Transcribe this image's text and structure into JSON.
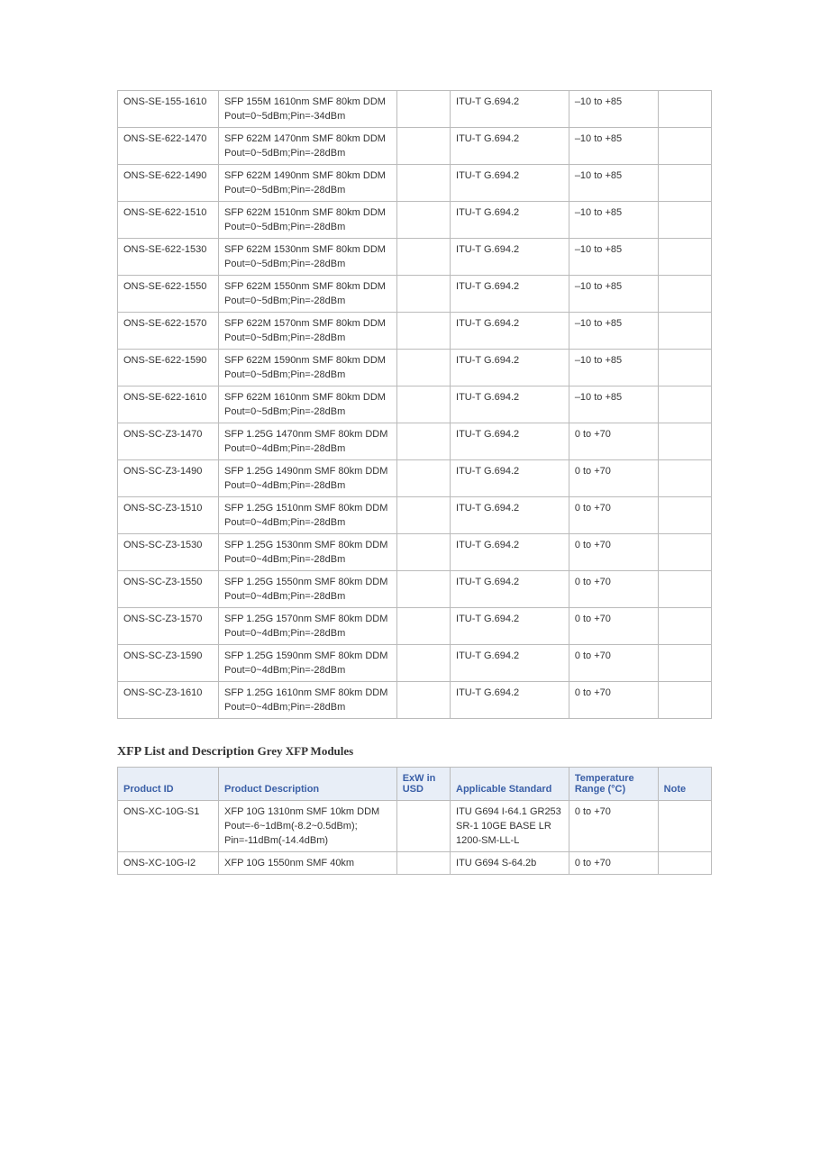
{
  "table1": {
    "rows": [
      {
        "id": "ONS-SE-155-1610",
        "desc": [
          "SFP 155M 1610nm SMF 80km DDM",
          "Pout=0~5dBm;Pin=-34dBm"
        ],
        "exw": "",
        "std": "ITU-T G.694.2",
        "temp": "–10 to +85",
        "note": ""
      },
      {
        "id": "ONS-SE-622-1470",
        "desc": [
          "SFP 622M 1470nm SMF 80km DDM",
          "Pout=0~5dBm;Pin=-28dBm"
        ],
        "exw": "",
        "std": "ITU-T G.694.2",
        "temp": "–10 to +85",
        "note": ""
      },
      {
        "id": "ONS-SE-622-1490",
        "desc": [
          "SFP 622M 1490nm SMF 80km DDM",
          "Pout=0~5dBm;Pin=-28dBm"
        ],
        "exw": "",
        "std": "ITU-T G.694.2",
        "temp": "–10 to +85",
        "note": ""
      },
      {
        "id": "ONS-SE-622-1510",
        "desc": [
          "SFP 622M 1510nm SMF 80km DDM",
          "Pout=0~5dBm;Pin=-28dBm"
        ],
        "exw": "",
        "std": "ITU-T G.694.2",
        "temp": "–10 to +85",
        "note": ""
      },
      {
        "id": "ONS-SE-622-1530",
        "desc": [
          "SFP 622M 1530nm SMF 80km DDM",
          "Pout=0~5dBm;Pin=-28dBm"
        ],
        "exw": "",
        "std": "ITU-T G.694.2",
        "temp": "–10 to +85",
        "note": ""
      },
      {
        "id": "ONS-SE-622-1550",
        "desc": [
          "SFP 622M 1550nm SMF 80km DDM",
          "Pout=0~5dBm;Pin=-28dBm"
        ],
        "exw": "",
        "std": "ITU-T G.694.2",
        "temp": "–10 to +85",
        "note": ""
      },
      {
        "id": "ONS-SE-622-1570",
        "desc": [
          "SFP 622M 1570nm SMF 80km DDM",
          "Pout=0~5dBm;Pin=-28dBm"
        ],
        "exw": "",
        "std": "ITU-T G.694.2",
        "temp": "–10 to +85",
        "note": ""
      },
      {
        "id": "ONS-SE-622-1590",
        "desc": [
          "SFP 622M 1590nm SMF 80km DDM",
          "Pout=0~5dBm;Pin=-28dBm"
        ],
        "exw": "",
        "std": "ITU-T G.694.2",
        "temp": "–10 to +85",
        "note": ""
      },
      {
        "id": "ONS-SE-622-1610",
        "desc": [
          "SFP 622M 1610nm SMF 80km DDM",
          "Pout=0~5dBm;Pin=-28dBm"
        ],
        "exw": "",
        "std": "ITU-T G.694.2",
        "temp": "–10 to +85",
        "note": ""
      },
      {
        "id": "ONS-SC-Z3-1470",
        "desc": [
          "SFP 1.25G 1470nm SMF 80km DDM",
          "Pout=0~4dBm;Pin=-28dBm"
        ],
        "exw": "",
        "std": "ITU-T G.694.2",
        "temp": "0 to +70",
        "note": ""
      },
      {
        "id": "ONS-SC-Z3-1490",
        "desc": [
          "SFP 1.25G 1490nm SMF 80km DDM",
          "Pout=0~4dBm;Pin=-28dBm"
        ],
        "exw": "",
        "std": "ITU-T G.694.2",
        "temp": "0 to +70",
        "note": ""
      },
      {
        "id": "ONS-SC-Z3-1510",
        "desc": [
          "SFP 1.25G 1510nm SMF 80km DDM",
          "Pout=0~4dBm;Pin=-28dBm"
        ],
        "exw": "",
        "std": "ITU-T G.694.2",
        "temp": "0 to +70",
        "note": ""
      },
      {
        "id": "ONS-SC-Z3-1530",
        "desc": [
          "SFP 1.25G 1530nm SMF 80km DDM",
          "Pout=0~4dBm;Pin=-28dBm"
        ],
        "exw": "",
        "std": "ITU-T G.694.2",
        "temp": "0 to +70",
        "note": ""
      },
      {
        "id": "ONS-SC-Z3-1550",
        "desc": [
          "SFP 1.25G 1550nm SMF 80km DDM",
          "Pout=0~4dBm;Pin=-28dBm"
        ],
        "exw": "",
        "std": "ITU-T G.694.2",
        "temp": "0 to +70",
        "note": ""
      },
      {
        "id": "ONS-SC-Z3-1570",
        "desc": [
          "SFP 1.25G 1570nm SMF 80km DDM",
          "Pout=0~4dBm;Pin=-28dBm"
        ],
        "exw": "",
        "std": "ITU-T G.694.2",
        "temp": "0 to +70",
        "note": ""
      },
      {
        "id": "ONS-SC-Z3-1590",
        "desc": [
          "SFP 1.25G 1590nm SMF 80km DDM",
          "Pout=0~4dBm;Pin=-28dBm"
        ],
        "exw": "",
        "std": "ITU-T G.694.2",
        "temp": "0 to +70",
        "note": ""
      },
      {
        "id": "ONS-SC-Z3-1610",
        "desc": [
          "SFP 1.25G 1610nm SMF 80km DDM",
          "Pout=0~4dBm;Pin=-28dBm"
        ],
        "exw": "",
        "std": "ITU-T G.694.2",
        "temp": "0 to +70",
        "note": ""
      }
    ]
  },
  "section_title": {
    "main": "XFP List and Description",
    "sub": "Grey XFP Modules"
  },
  "table2": {
    "headers": {
      "id": "Product ID",
      "desc": "Product Description",
      "exw": [
        "ExW in",
        "USD"
      ],
      "std": "Applicable Standard",
      "temp": [
        "Temperature",
        "Range (°C)"
      ],
      "note": "Note"
    },
    "rows": [
      {
        "id": "ONS-XC-10G-S1",
        "desc": [
          "XFP 10G 1310nm SMF 10km DDM",
          "Pout=-6~1dBm(-8.2~0.5dBm);",
          "Pin=-11dBm(-14.4dBm)"
        ],
        "exw": "",
        "std": [
          "ITU G694 I-64.1 GR253",
          "SR-1 10GE BASE LR",
          "1200-SM-LL-L"
        ],
        "temp": "0 to +70",
        "note": ""
      },
      {
        "id": "ONS-XC-10G-I2",
        "desc": [
          "XFP 10G 1550nm SMF 40km"
        ],
        "exw": "",
        "std": [
          "ITU G694 S-64.2b"
        ],
        "temp": "0 to +70",
        "note": ""
      }
    ]
  }
}
